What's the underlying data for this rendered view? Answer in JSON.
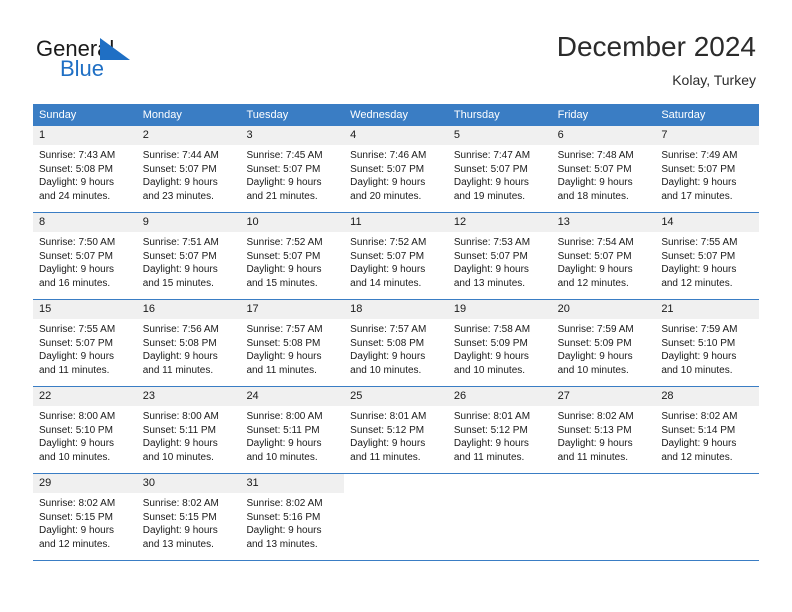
{
  "brand": {
    "word_general": "General",
    "word_blue": "Blue",
    "mark": "triangle-logo-icon",
    "accent_color": "#1f6fc4"
  },
  "header": {
    "title": "December 2024",
    "subtitle": "Kolay, Turkey"
  },
  "colors": {
    "header_bar": "#3a7dc4",
    "day_number_band": "#f0f0f0",
    "row_separator": "#3a7dc4",
    "text": "#1a1a1a"
  },
  "weekdays": [
    "Sunday",
    "Monday",
    "Tuesday",
    "Wednesday",
    "Thursday",
    "Friday",
    "Saturday"
  ],
  "weeks": [
    [
      {
        "day": "1",
        "sunrise": "Sunrise: 7:43 AM",
        "sunset": "Sunset: 5:08 PM",
        "daylight1": "Daylight: 9 hours",
        "daylight2": "and 24 minutes."
      },
      {
        "day": "2",
        "sunrise": "Sunrise: 7:44 AM",
        "sunset": "Sunset: 5:07 PM",
        "daylight1": "Daylight: 9 hours",
        "daylight2": "and 23 minutes."
      },
      {
        "day": "3",
        "sunrise": "Sunrise: 7:45 AM",
        "sunset": "Sunset: 5:07 PM",
        "daylight1": "Daylight: 9 hours",
        "daylight2": "and 21 minutes."
      },
      {
        "day": "4",
        "sunrise": "Sunrise: 7:46 AM",
        "sunset": "Sunset: 5:07 PM",
        "daylight1": "Daylight: 9 hours",
        "daylight2": "and 20 minutes."
      },
      {
        "day": "5",
        "sunrise": "Sunrise: 7:47 AM",
        "sunset": "Sunset: 5:07 PM",
        "daylight1": "Daylight: 9 hours",
        "daylight2": "and 19 minutes."
      },
      {
        "day": "6",
        "sunrise": "Sunrise: 7:48 AM",
        "sunset": "Sunset: 5:07 PM",
        "daylight1": "Daylight: 9 hours",
        "daylight2": "and 18 minutes."
      },
      {
        "day": "7",
        "sunrise": "Sunrise: 7:49 AM",
        "sunset": "Sunset: 5:07 PM",
        "daylight1": "Daylight: 9 hours",
        "daylight2": "and 17 minutes."
      }
    ],
    [
      {
        "day": "8",
        "sunrise": "Sunrise: 7:50 AM",
        "sunset": "Sunset: 5:07 PM",
        "daylight1": "Daylight: 9 hours",
        "daylight2": "and 16 minutes."
      },
      {
        "day": "9",
        "sunrise": "Sunrise: 7:51 AM",
        "sunset": "Sunset: 5:07 PM",
        "daylight1": "Daylight: 9 hours",
        "daylight2": "and 15 minutes."
      },
      {
        "day": "10",
        "sunrise": "Sunrise: 7:52 AM",
        "sunset": "Sunset: 5:07 PM",
        "daylight1": "Daylight: 9 hours",
        "daylight2": "and 15 minutes."
      },
      {
        "day": "11",
        "sunrise": "Sunrise: 7:52 AM",
        "sunset": "Sunset: 5:07 PM",
        "daylight1": "Daylight: 9 hours",
        "daylight2": "and 14 minutes."
      },
      {
        "day": "12",
        "sunrise": "Sunrise: 7:53 AM",
        "sunset": "Sunset: 5:07 PM",
        "daylight1": "Daylight: 9 hours",
        "daylight2": "and 13 minutes."
      },
      {
        "day": "13",
        "sunrise": "Sunrise: 7:54 AM",
        "sunset": "Sunset: 5:07 PM",
        "daylight1": "Daylight: 9 hours",
        "daylight2": "and 12 minutes."
      },
      {
        "day": "14",
        "sunrise": "Sunrise: 7:55 AM",
        "sunset": "Sunset: 5:07 PM",
        "daylight1": "Daylight: 9 hours",
        "daylight2": "and 12 minutes."
      }
    ],
    [
      {
        "day": "15",
        "sunrise": "Sunrise: 7:55 AM",
        "sunset": "Sunset: 5:07 PM",
        "daylight1": "Daylight: 9 hours",
        "daylight2": "and 11 minutes."
      },
      {
        "day": "16",
        "sunrise": "Sunrise: 7:56 AM",
        "sunset": "Sunset: 5:08 PM",
        "daylight1": "Daylight: 9 hours",
        "daylight2": "and 11 minutes."
      },
      {
        "day": "17",
        "sunrise": "Sunrise: 7:57 AM",
        "sunset": "Sunset: 5:08 PM",
        "daylight1": "Daylight: 9 hours",
        "daylight2": "and 11 minutes."
      },
      {
        "day": "18",
        "sunrise": "Sunrise: 7:57 AM",
        "sunset": "Sunset: 5:08 PM",
        "daylight1": "Daylight: 9 hours",
        "daylight2": "and 10 minutes."
      },
      {
        "day": "19",
        "sunrise": "Sunrise: 7:58 AM",
        "sunset": "Sunset: 5:09 PM",
        "daylight1": "Daylight: 9 hours",
        "daylight2": "and 10 minutes."
      },
      {
        "day": "20",
        "sunrise": "Sunrise: 7:59 AM",
        "sunset": "Sunset: 5:09 PM",
        "daylight1": "Daylight: 9 hours",
        "daylight2": "and 10 minutes."
      },
      {
        "day": "21",
        "sunrise": "Sunrise: 7:59 AM",
        "sunset": "Sunset: 5:10 PM",
        "daylight1": "Daylight: 9 hours",
        "daylight2": "and 10 minutes."
      }
    ],
    [
      {
        "day": "22",
        "sunrise": "Sunrise: 8:00 AM",
        "sunset": "Sunset: 5:10 PM",
        "daylight1": "Daylight: 9 hours",
        "daylight2": "and 10 minutes."
      },
      {
        "day": "23",
        "sunrise": "Sunrise: 8:00 AM",
        "sunset": "Sunset: 5:11 PM",
        "daylight1": "Daylight: 9 hours",
        "daylight2": "and 10 minutes."
      },
      {
        "day": "24",
        "sunrise": "Sunrise: 8:00 AM",
        "sunset": "Sunset: 5:11 PM",
        "daylight1": "Daylight: 9 hours",
        "daylight2": "and 10 minutes."
      },
      {
        "day": "25",
        "sunrise": "Sunrise: 8:01 AM",
        "sunset": "Sunset: 5:12 PM",
        "daylight1": "Daylight: 9 hours",
        "daylight2": "and 11 minutes."
      },
      {
        "day": "26",
        "sunrise": "Sunrise: 8:01 AM",
        "sunset": "Sunset: 5:12 PM",
        "daylight1": "Daylight: 9 hours",
        "daylight2": "and 11 minutes."
      },
      {
        "day": "27",
        "sunrise": "Sunrise: 8:02 AM",
        "sunset": "Sunset: 5:13 PM",
        "daylight1": "Daylight: 9 hours",
        "daylight2": "and 11 minutes."
      },
      {
        "day": "28",
        "sunrise": "Sunrise: 8:02 AM",
        "sunset": "Sunset: 5:14 PM",
        "daylight1": "Daylight: 9 hours",
        "daylight2": "and 12 minutes."
      }
    ],
    [
      {
        "day": "29",
        "sunrise": "Sunrise: 8:02 AM",
        "sunset": "Sunset: 5:15 PM",
        "daylight1": "Daylight: 9 hours",
        "daylight2": "and 12 minutes."
      },
      {
        "day": "30",
        "sunrise": "Sunrise: 8:02 AM",
        "sunset": "Sunset: 5:15 PM",
        "daylight1": "Daylight: 9 hours",
        "daylight2": "and 13 minutes."
      },
      {
        "day": "31",
        "sunrise": "Sunrise: 8:02 AM",
        "sunset": "Sunset: 5:16 PM",
        "daylight1": "Daylight: 9 hours",
        "daylight2": "and 13 minutes."
      },
      {
        "day": "",
        "sunrise": "",
        "sunset": "",
        "daylight1": "",
        "daylight2": ""
      },
      {
        "day": "",
        "sunrise": "",
        "sunset": "",
        "daylight1": "",
        "daylight2": ""
      },
      {
        "day": "",
        "sunrise": "",
        "sunset": "",
        "daylight1": "",
        "daylight2": ""
      },
      {
        "day": "",
        "sunrise": "",
        "sunset": "",
        "daylight1": "",
        "daylight2": ""
      }
    ]
  ]
}
